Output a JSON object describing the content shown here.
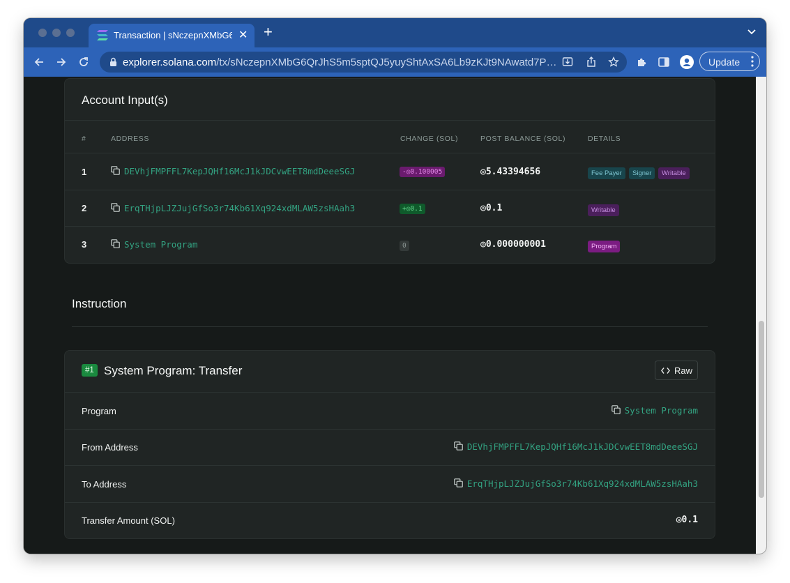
{
  "browser": {
    "tab_title": "Transaction | sNczepnXMbG6",
    "url_host": "explorer.solana.com",
    "url_path": "/tx/sNczepnXMbG6QrJhS5m5sptQJ5yuyShtAxSA6Lb9zKJt9NAwatd7PK...",
    "update_label": "Update"
  },
  "account_inputs": {
    "title": "Account Input(s)",
    "headers": {
      "num": "#",
      "address": "ADDRESS",
      "change": "CHANGE (SOL)",
      "post_balance": "POST BALANCE (SOL)",
      "details": "DETAILS"
    },
    "rows": [
      {
        "num": "1",
        "address": "DEVhjFMPFFL7KepJQHf16McJ1kJDCvwEET8mdDeeeSGJ",
        "change": "-◎0.100005",
        "post_balance": "◎5.43394656",
        "badges": [
          "Fee Payer",
          "Signer",
          "Writable"
        ]
      },
      {
        "num": "2",
        "address": "ErqTHjpLJZJujGfSo3r74Kb61Xq924xdMLAW5zsHAah3",
        "change": "+◎0.1",
        "post_balance": "◎0.1",
        "badges": [
          "Writable"
        ]
      },
      {
        "num": "3",
        "address": "System Program",
        "change": "0",
        "post_balance": "◎0.000000001",
        "badges": [
          "Program"
        ]
      }
    ]
  },
  "instruction": {
    "section_title": "Instruction",
    "index_badge": "#1",
    "card_title": "System Program: Transfer",
    "raw_label": "Raw",
    "fields": [
      {
        "label": "Program",
        "value": "System Program"
      },
      {
        "label": "From Address",
        "value": "DEVhjFMPFFL7KepJQHf16McJ1kJDCvwEET8mdDeeeSGJ"
      },
      {
        "label": "To Address",
        "value": "ErqTHjpLJZJujGfSo3r74Kb61Xq924xdMLAW5zsHAah3"
      },
      {
        "label": "Transfer Amount (SOL)",
        "value": "◎0.1"
      }
    ]
  },
  "colors": {
    "link_green": "#33a382",
    "page_bg": "#161a19",
    "card_bg": "#202524",
    "chrome_blue": "#2d63b8"
  }
}
